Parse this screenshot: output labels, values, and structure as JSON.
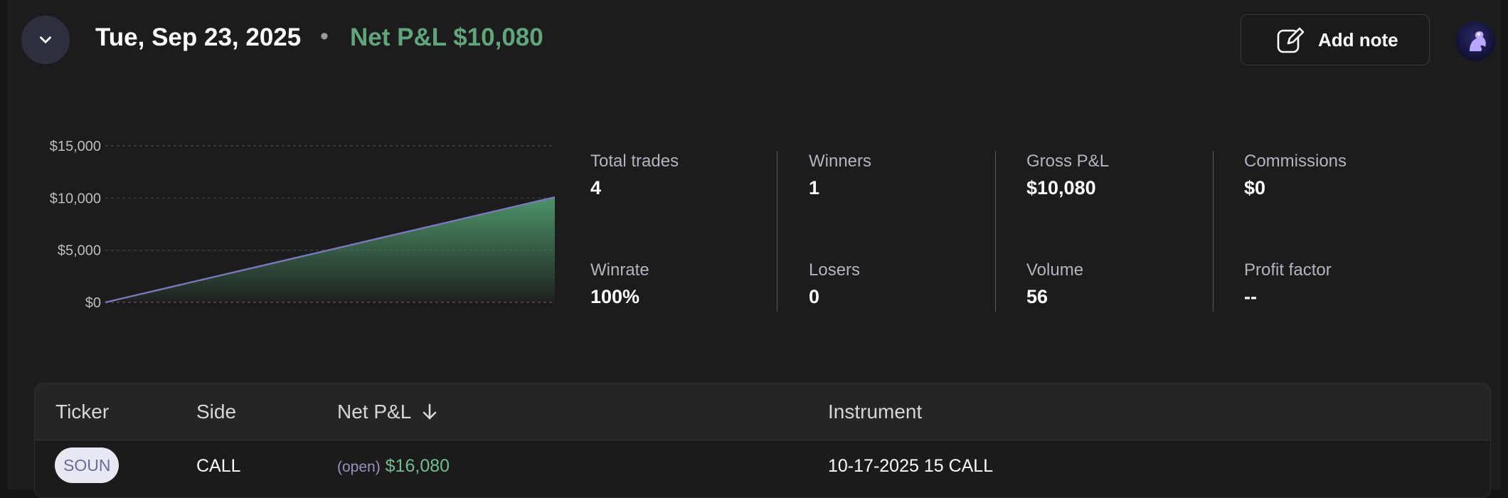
{
  "header": {
    "date": "Tue, Sep 23, 2025",
    "separator": "•",
    "net_pnl_text": "Net P&L $10,080",
    "add_note_label": "Add note"
  },
  "colors": {
    "positive": "#5fa67a",
    "line": "#7a78c0",
    "area_top": "#4f9a6c",
    "background": "#1c1c1c"
  },
  "chart_data": {
    "type": "area",
    "x": [
      0,
      1
    ],
    "values": [
      0,
      10080
    ],
    "ylim": [
      0,
      15000
    ],
    "yticks": [
      "$0",
      "$5,000",
      "$10,000",
      "$15,000"
    ],
    "ytick_values": [
      0,
      5000,
      10000,
      15000
    ],
    "grid": true,
    "title": "",
    "xlabel": "",
    "ylabel": ""
  },
  "stats": [
    {
      "label": "Total trades",
      "value": "4"
    },
    {
      "label": "Winrate",
      "value": "100%"
    },
    {
      "label": "Winners",
      "value": "1"
    },
    {
      "label": "Losers",
      "value": "0"
    },
    {
      "label": "Gross P&L",
      "value": "$10,080"
    },
    {
      "label": "Volume",
      "value": "56"
    },
    {
      "label": "Commissions",
      "value": "$0"
    },
    {
      "label": "Profit factor",
      "value": "--"
    }
  ],
  "table": {
    "columns": [
      "Ticker",
      "Side",
      "Net P&L",
      "Instrument"
    ],
    "sort_icon": "arrow-down-icon",
    "rows": [
      {
        "ticker": "SOUN",
        "side": "CALL",
        "status": "(open)",
        "net_pnl": "$16,080",
        "instrument": "10-17-2025 15 CALL"
      }
    ]
  }
}
